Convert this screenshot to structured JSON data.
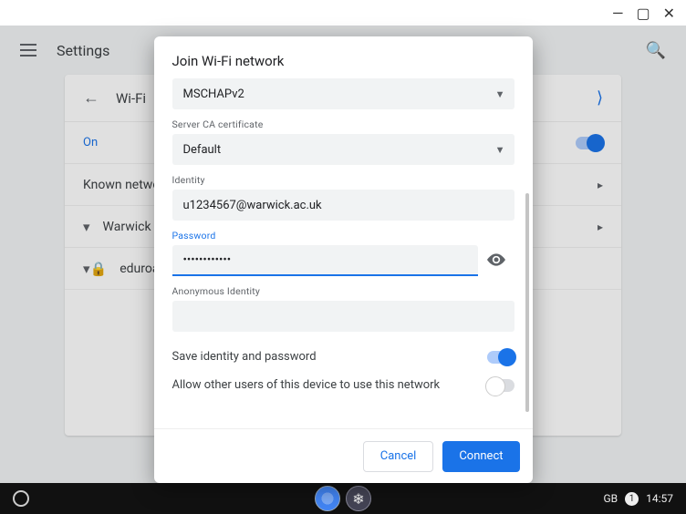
{
  "window": {
    "minimize": "—",
    "maximize": "▢",
    "close": "✕"
  },
  "settings": {
    "title": "Settings",
    "page_title": "Wi-Fi",
    "on_label": "On",
    "known_label": "Known networks",
    "networks": [
      {
        "name": "Warwick"
      },
      {
        "name": "eduroam"
      }
    ]
  },
  "dialog": {
    "title": "Join Wi-Fi network",
    "phase2": {
      "value": "MSCHAPv2"
    },
    "ca_cert": {
      "label": "Server CA certificate",
      "value": "Default"
    },
    "identity": {
      "label": "Identity",
      "value": "u1234567@warwick.ac.uk"
    },
    "password": {
      "label": "Password",
      "value": "••••••••••••"
    },
    "anon": {
      "label": "Anonymous Identity",
      "value": ""
    },
    "save_identity": {
      "label": "Save identity and password",
      "on": true
    },
    "share": {
      "label": "Allow other users of this device to use this network",
      "on": false
    },
    "cancel": "Cancel",
    "connect": "Connect"
  },
  "shelf": {
    "locale": "GB",
    "notif_count": "1",
    "clock": "14:57"
  }
}
